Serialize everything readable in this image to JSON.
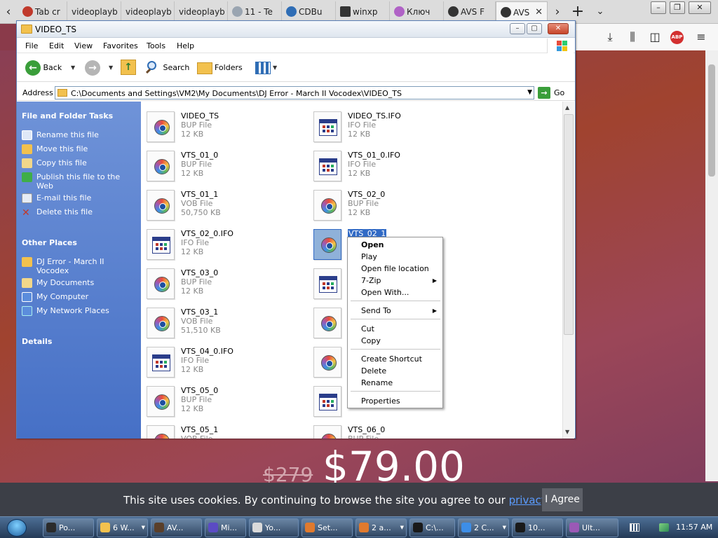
{
  "browser": {
    "tabs": [
      {
        "label": "Tab cr",
        "active": false
      },
      {
        "label": "videoplayb",
        "active": false
      },
      {
        "label": "videoplayb",
        "active": false
      },
      {
        "label": "videoplayb",
        "active": false
      },
      {
        "label": "11 - Te",
        "active": false
      },
      {
        "label": "CDBu",
        "active": false
      },
      {
        "label": "winxp",
        "active": false
      },
      {
        "label": "Ключ",
        "active": false
      },
      {
        "label": "AVS F",
        "active": false
      },
      {
        "label": "AVS",
        "active": true
      }
    ],
    "toolbar_icons": [
      "back-arrow-icon",
      "forward-arrow-icon",
      "new-tab-plus-icon",
      "list-all-tabs-icon",
      "downloads-icon",
      "library-icon",
      "sidebar-icon",
      "adblock-icon",
      "hamburger-menu-icon"
    ],
    "abp_label": "ABP"
  },
  "page": {
    "price_old": "$279",
    "price_new": "$79.00",
    "cookie_text": "This site uses cookies. By continuing to browse the site you agree to our ",
    "cookie_link": "privacy policy",
    "cookie_suffix": ".",
    "cookie_button": "I Agree"
  },
  "explorer": {
    "title": "VIDEO_TS",
    "menu": [
      "File",
      "Edit",
      "View",
      "Favorites",
      "Tools",
      "Help"
    ],
    "toolbar": {
      "back": "Back",
      "search": "Search",
      "folders": "Folders"
    },
    "address_label": "Address",
    "address_value": "C:\\Documents and Settings\\VM2\\My Documents\\DJ Error - March II Vocodex\\VIDEO_TS",
    "go_label": "Go",
    "tasks_header": "File and Folder Tasks",
    "tasks": [
      "Rename this file",
      "Move this file",
      "Copy this file",
      "Publish this file to the Web",
      "E-mail this file",
      "Delete this file"
    ],
    "places_header": "Other Places",
    "places": [
      "DJ Error - March II Vocodex",
      "My Documents",
      "My Computer",
      "My Network Places"
    ],
    "details_header": "Details",
    "files": [
      {
        "name": "VIDEO_TS",
        "type": "BUP File",
        "size": "12 KB",
        "icon": "bup"
      },
      {
        "name": "VIDEO_TS.IFO",
        "type": "IFO File",
        "size": "12 KB",
        "icon": "ifo"
      },
      {
        "name": "VTS_01_0",
        "type": "BUP File",
        "size": "12 KB",
        "icon": "bup"
      },
      {
        "name": "VTS_01_0.IFO",
        "type": "IFO File",
        "size": "12 KB",
        "icon": "ifo"
      },
      {
        "name": "VTS_01_1",
        "type": "VOB File",
        "size": "50,750 KB",
        "icon": "vob"
      },
      {
        "name": "VTS_02_0",
        "type": "BUP File",
        "size": "12 KB",
        "icon": "bup"
      },
      {
        "name": "VTS_02_0.IFO",
        "type": "IFO File",
        "size": "12 KB",
        "icon": "ifo"
      },
      {
        "name": "VTS_02_1",
        "type": "",
        "size": "",
        "icon": "vob",
        "selected": true
      },
      {
        "name": "VTS_03_0",
        "type": "BUP File",
        "size": "12 KB",
        "icon": "bup"
      },
      {
        "name": "",
        "type": "",
        "size": "",
        "icon": "ifo"
      },
      {
        "name": "VTS_03_1",
        "type": "VOB File",
        "size": "51,510 KB",
        "icon": "vob"
      },
      {
        "name": "",
        "type": "",
        "size": "",
        "icon": "bup"
      },
      {
        "name": "VTS_04_0.IFO",
        "type": "IFO File",
        "size": "12 KB",
        "icon": "ifo"
      },
      {
        "name": "",
        "type": "",
        "size": "",
        "icon": "vob"
      },
      {
        "name": "VTS_05_0",
        "type": "BUP File",
        "size": "12 KB",
        "icon": "bup"
      },
      {
        "name": "",
        "type": "",
        "size": "",
        "icon": "ifo"
      },
      {
        "name": "VTS_05_1",
        "type": "VOB File",
        "size": "",
        "icon": "vob"
      },
      {
        "name": "VTS_06_0",
        "type": "BUP File",
        "size": "",
        "icon": "bup"
      }
    ],
    "context_menu": {
      "open": "Open",
      "play": "Play",
      "open_location": "Open file location",
      "zip": "7-Zip",
      "open_with": "Open With...",
      "send_to": "Send To",
      "cut": "Cut",
      "copy": "Copy",
      "create_shortcut": "Create Shortcut",
      "delete": "Delete",
      "rename": "Rename",
      "properties": "Properties"
    }
  },
  "taskbar": {
    "buttons": [
      {
        "label": "Po...",
        "color": "#2b2b2b"
      },
      {
        "label": "6 W...",
        "color": "#f2c14e",
        "dropdown": true
      },
      {
        "label": "AV...",
        "color": "#5a3f2a"
      },
      {
        "label": "Mi...",
        "color": "#5b4bc4"
      },
      {
        "label": "Yo...",
        "color": "#dadada"
      },
      {
        "label": "Set...",
        "color": "#e07a2e"
      },
      {
        "label": "2 a...",
        "color": "#e07a2e",
        "dropdown": true
      },
      {
        "label": "C:\\...",
        "color": "#1a1a1a"
      },
      {
        "label": "2 C...",
        "color": "#3d8ee8",
        "dropdown": true
      },
      {
        "label": "10...",
        "color": "#1a1a1a"
      },
      {
        "label": "Ult...",
        "color": "#9b59b6"
      }
    ],
    "clock": "11:57 AM"
  },
  "colors": {
    "xp_task_pane": "#4670c6",
    "selection": "#316ac5",
    "cookie_bar": "#3c3f47"
  }
}
